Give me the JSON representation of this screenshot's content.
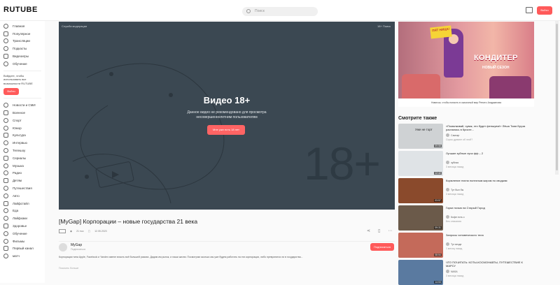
{
  "header": {
    "logo": "RUTUBE",
    "search_placeholder": "Поиск",
    "login_label": "Войти"
  },
  "sidebar": {
    "main": [
      {
        "label": "Главная",
        "icon": "home-icon"
      },
      {
        "label": "Популярное",
        "icon": "fire-icon"
      },
      {
        "label": "Трансляции",
        "icon": "broadcast-icon"
      },
      {
        "label": "Подкасты",
        "icon": "podcast-icon"
      },
      {
        "label": "Видеоигры",
        "icon": "gamepad-icon"
      },
      {
        "label": "Обучение",
        "icon": "book-icon"
      }
    ],
    "note": "Войдите, чтобы использовать все возможности RUTUBE",
    "login_label": "Войти",
    "categories": [
      {
        "label": "Новости и СМИ",
        "icon": "news-icon"
      },
      {
        "label": "Военное",
        "icon": "star-icon"
      },
      {
        "label": "Спорт",
        "icon": "sport-icon"
      },
      {
        "label": "Юмор",
        "icon": "smile-icon"
      },
      {
        "label": "Культура",
        "icon": "theater-icon"
      },
      {
        "label": "Интервью",
        "icon": "mic-icon"
      },
      {
        "label": "Телешоу",
        "icon": "tv-icon"
      },
      {
        "label": "Сериалы",
        "icon": "film-icon"
      },
      {
        "label": "Музыка",
        "icon": "music-icon"
      },
      {
        "label": "Радио",
        "icon": "radio-icon"
      },
      {
        "label": "Детям",
        "icon": "kid-icon"
      },
      {
        "label": "Путешествия",
        "icon": "globe-icon"
      },
      {
        "label": "Авто",
        "icon": "car-icon"
      },
      {
        "label": "Лайфстайл",
        "icon": "leaf-icon"
      },
      {
        "label": "Еда",
        "icon": "food-icon"
      },
      {
        "label": "Лайфхаки",
        "icon": "lamp-icon"
      },
      {
        "label": "Здоровье",
        "icon": "heart-icon"
      },
      {
        "label": "Обучение",
        "icon": "cap-icon"
      },
      {
        "label": "Фильмы",
        "icon": "clapper-icon"
      },
      {
        "label": "Первый канал",
        "icon": "first-channel-icon"
      },
      {
        "label": "матч",
        "icon": "match-icon"
      }
    ]
  },
  "player": {
    "top_left": "Служба модерации",
    "top_right": "18+ Поиск",
    "title": "Видео 18+",
    "subtitle": "Данное видео не рекомендовано для просмотра несовершеннолетним пользователям",
    "confirm_label": "Мне уже есть 18 лет",
    "watermark": "18+"
  },
  "video": {
    "title": "[MyGap] Корпорации – новые государства 21 века",
    "views": "21 тыс",
    "date": "12.05.2023",
    "channel": "MyGap",
    "channel_sub": "Подписаться",
    "subscribe_label": "Подписаться",
    "description": "Корпорации типа Apple, Facebook и Yandex имеют власть всё большей размах. Дадим им рынок, и наши жизни. Посмотрим сколько мы уже будем работать на эти корпорации, либо превратятся ли в государства...",
    "show_more": "Показать больше"
  },
  "banner": {
    "logo": "ПЯТ НИЦА!",
    "title": "КОНДИТЕР",
    "season": "НОВЫЙ СЕЗОН",
    "caption": "Новичок, чтобы попасть в сказочный мир Ренато Агаджанова"
  },
  "related": {
    "title": "Смотрите также",
    "items": [
      {
        "title": "«Помалкивай, чувак, это будет феншуем!» Лёша Томи Бруза распалась в Кристе...",
        "channel": "Самокр",
        "views": "Сорок думают об этой?",
        "duration": "09:58",
        "thumb_text": "Уже не торт"
      },
      {
        "title": "Лучшие зубные лучи фф – 2",
        "channel": "зубная",
        "views": "3 месяца назад",
        "duration": "12:42",
        "thumb_text": ""
      },
      {
        "title": "Кормление пчела полезным жиром по сводкам",
        "channel": "Тут был бы",
        "views": "3 месяца назад",
        "duration": "03:57",
        "thumb_text": ""
      },
      {
        "title": "Горки ночью на Старый Город",
        "channel": "Кофе есть с",
        "views": "Без описания",
        "duration": "09:31",
        "thumb_text": ""
      },
      {
        "title": "Запросы человеческого тела",
        "channel": "Тут везде",
        "views": "1 месяц назад",
        "duration": "08:54",
        "thumb_text": ""
      },
      {
        "title": "ЧТО ПОЧИТАТЬ: КОТЫ-КОСМОНАВТЫ, ПУТЕШЕСТВИЕ К МАРСУ",
        "channel": "NASA",
        "views": "3 месяца назад",
        "duration": "14:53",
        "thumb_text": ""
      }
    ]
  },
  "colors": {
    "accent": "#ff5a5a",
    "player_bg": "#3b4852"
  }
}
